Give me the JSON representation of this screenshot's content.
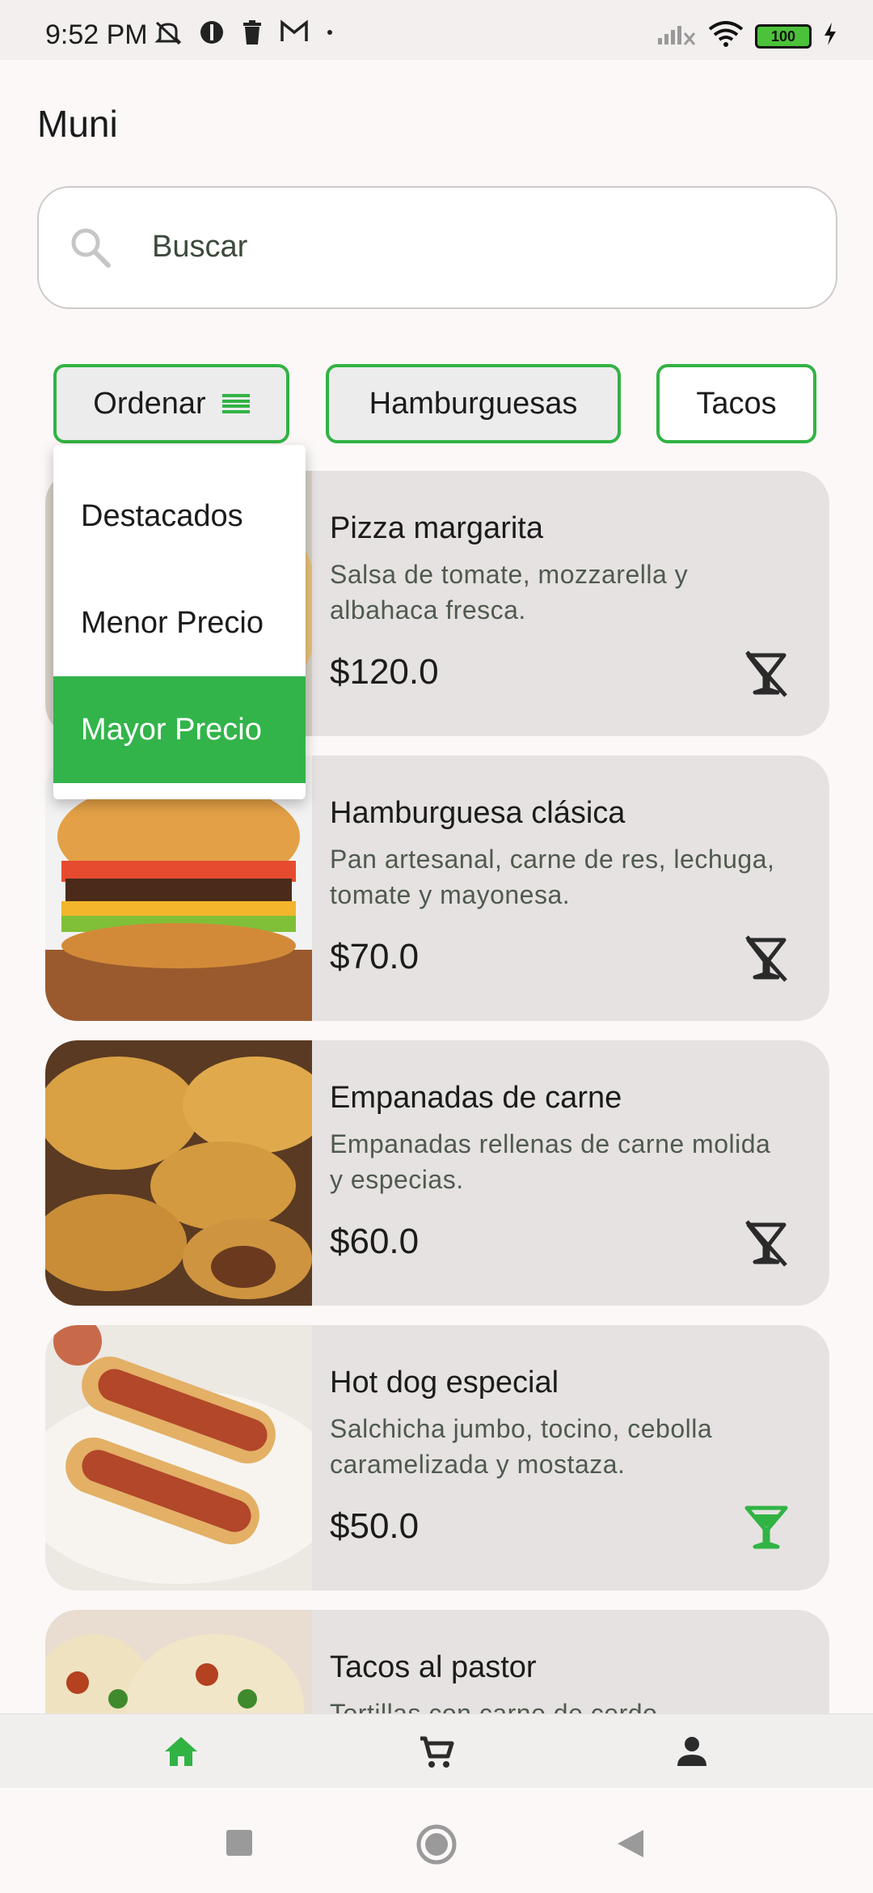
{
  "status_bar": {
    "time": "9:52 PM",
    "battery": "100"
  },
  "app": {
    "title": "Muni"
  },
  "search": {
    "placeholder": "Buscar",
    "icon": "search-icon"
  },
  "filters": {
    "order_label": "Ordenar",
    "chips": [
      "Hamburguesas",
      "Tacos"
    ]
  },
  "sort_menu": {
    "options": [
      "Destacados",
      "Menor Precio",
      "Mayor Precio"
    ],
    "selected": "Mayor Precio"
  },
  "products": [
    {
      "name": "Pizza margarita",
      "description": "Salsa de tomate, mozzarella y albahaca fresca.",
      "price": "$120.0",
      "alcohol_icon": "no-drink-icon"
    },
    {
      "name": "Hamburguesa clásica",
      "description": "Pan artesanal, carne de res, lechuga, tomate y mayonesa.",
      "price": "$70.0",
      "alcohol_icon": "no-drink-icon"
    },
    {
      "name": "Empanadas de carne",
      "description": "Empanadas rellenas de carne molida y especias.",
      "price": "$60.0",
      "alcohol_icon": "no-drink-icon"
    },
    {
      "name": "Hot dog especial",
      "description": "Salchicha jumbo, tocino, cebolla caramelizada y mostaza.",
      "price": "$50.0",
      "alcohol_icon": "drink-icon"
    },
    {
      "name": "Tacos al pastor",
      "description": "Tortillas con carne de cerdo",
      "price": "",
      "alcohol_icon": ""
    }
  ],
  "bottom_nav": [
    "home-icon",
    "cart-icon",
    "profile-icon"
  ],
  "colors": {
    "accent": "#31b344",
    "card": "#e6e2e1",
    "background": "#fbf8f7"
  }
}
